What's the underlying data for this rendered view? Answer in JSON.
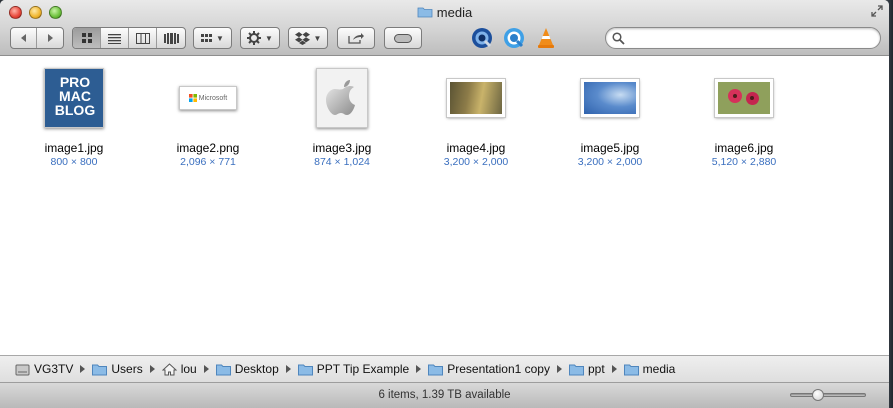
{
  "window": {
    "title": "media"
  },
  "toolbar": {
    "back_icon": "back-arrow-icon",
    "forward_icon": "forward-arrow-icon",
    "views": [
      "icon-view",
      "list-view",
      "column-view",
      "cover-flow-view"
    ],
    "active_view": "icon-view",
    "apps": [
      "quicktime-icon",
      "quicktime-alt-icon",
      "vlc-icon"
    ],
    "search": {
      "value": "",
      "placeholder": ""
    }
  },
  "files": [
    {
      "name": "image1.jpg",
      "dims": "800 × 800"
    },
    {
      "name": "image2.png",
      "dims": "2,096 × 771"
    },
    {
      "name": "image3.jpg",
      "dims": "874 × 1,024"
    },
    {
      "name": "image4.jpg",
      "dims": "3,200 × 2,000"
    },
    {
      "name": "image5.jpg",
      "dims": "3,200 × 2,000"
    },
    {
      "name": "image6.jpg",
      "dims": "5,120 × 2,880"
    }
  ],
  "thumbs": {
    "promac_lines": [
      "PRO",
      "MAC",
      "BLOG"
    ],
    "microsoft_text": "Microsoft"
  },
  "pathbar": [
    {
      "label": "VG3TV",
      "icon": "hard-drive-icon"
    },
    {
      "label": "Users",
      "icon": "folder-icon"
    },
    {
      "label": "lou",
      "icon": "home-icon"
    },
    {
      "label": "Desktop",
      "icon": "folder-icon"
    },
    {
      "label": "PPT Tip Example",
      "icon": "folder-icon"
    },
    {
      "label": "Presentation1 copy",
      "icon": "folder-icon"
    },
    {
      "label": "ppt",
      "icon": "folder-icon"
    },
    {
      "label": "media",
      "icon": "folder-icon"
    }
  ],
  "status": {
    "text": "6 items, 1.39 TB available",
    "icon_size_level": 0.34
  },
  "colors": {
    "dims_text": "#3a6fbf",
    "folder_blue": "#7fb1dd"
  }
}
